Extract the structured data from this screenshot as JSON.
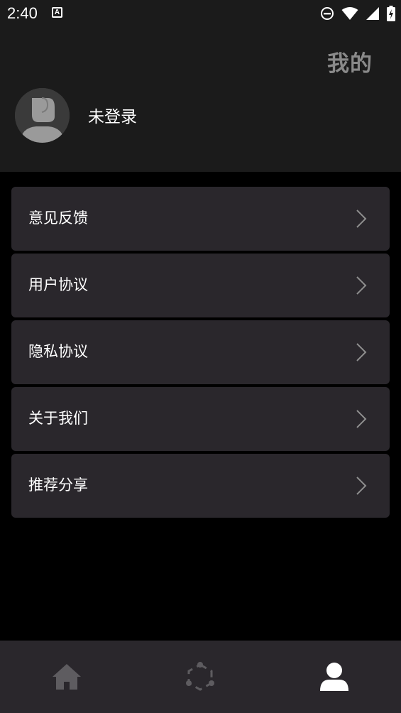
{
  "status_bar": {
    "time": "2:40",
    "notification_icon_letter": "A",
    "icons": [
      "a-notification-icon",
      "do-not-disturb-icon",
      "wifi-icon",
      "signal-icon",
      "battery-charging-icon"
    ]
  },
  "header": {
    "title": "我的",
    "username": "未登录",
    "avatar_icon": "default-avatar-icon"
  },
  "menu": {
    "items": [
      {
        "label": "意见反馈",
        "icon": "chevron-right-icon"
      },
      {
        "label": "用户协议",
        "icon": "chevron-right-icon"
      },
      {
        "label": "隐私协议",
        "icon": "chevron-right-icon"
      },
      {
        "label": "关于我们",
        "icon": "chevron-right-icon"
      },
      {
        "label": "推荐分享",
        "icon": "chevron-right-icon"
      }
    ]
  },
  "bottom_nav": {
    "items": [
      {
        "icon": "home-icon",
        "active": false
      },
      {
        "icon": "hexagon-nodes-icon",
        "active": false
      },
      {
        "icon": "person-icon",
        "active": true
      }
    ]
  },
  "colors": {
    "background": "#000000",
    "header_bg": "#1b1b1b",
    "card_bg": "#2a272c",
    "title_text": "#8a8a8a",
    "text": "#ffffff",
    "inactive_icon": "#5e5c60",
    "active_icon": "#ffffff",
    "chevron": "#8f8f8f"
  }
}
